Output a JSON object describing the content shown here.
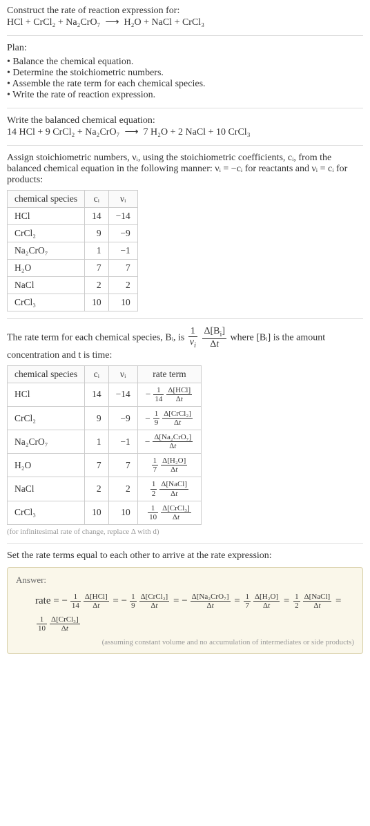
{
  "intro": {
    "line1": "Construct the rate of reaction expression for:",
    "eq_lhs": "HCl + CrCl₂ + Na₂CrO₇",
    "arrow": "⟶",
    "eq_rhs": "H₂O + NaCl + CrCl₃"
  },
  "plan": {
    "heading": "Plan:",
    "items": [
      "Balance the chemical equation.",
      "Determine the stoichiometric numbers.",
      "Assemble the rate term for each chemical species.",
      "Write the rate of reaction expression."
    ]
  },
  "balanced": {
    "heading": "Write the balanced chemical equation:",
    "eq_lhs": "14 HCl + 9 CrCl₂ + Na₂CrO₇",
    "arrow": "⟶",
    "eq_rhs": "7 H₂O + 2 NaCl + 10 CrCl₃"
  },
  "stoich": {
    "heading": "Assign stoichiometric numbers, νᵢ, using the stoichiometric coefficients, cᵢ, from the balanced chemical equation in the following manner: νᵢ = −cᵢ for reactants and νᵢ = cᵢ for products:",
    "cols": [
      "chemical species",
      "cᵢ",
      "νᵢ"
    ]
  },
  "rate_intro": {
    "prefix": "The rate term for each chemical species, Bᵢ, is ",
    "mid": " where [Bᵢ] is the amount concentration and t is time:",
    "cols": [
      "chemical species",
      "cᵢ",
      "νᵢ",
      "rate term"
    ],
    "footnote": "(for infinitesimal rate of change, replace Δ with d)"
  },
  "final": {
    "heading": "Set the rate terms equal to each other to arrive at the rate expression:",
    "answer_label": "Answer:",
    "rate_prefix": "rate = ",
    "footnote": "(assuming constant volume and no accumulation of intermediates or side products)"
  },
  "chart_data": {
    "type": "table",
    "stoichiometry": {
      "columns": [
        "chemical species",
        "c_i",
        "nu_i"
      ],
      "rows": [
        {
          "species": "HCl",
          "c": 14,
          "nu": -14
        },
        {
          "species": "CrCl₂",
          "c": 9,
          "nu": -9
        },
        {
          "species": "Na₂CrO₇",
          "c": 1,
          "nu": -1
        },
        {
          "species": "H₂O",
          "c": 7,
          "nu": 7
        },
        {
          "species": "NaCl",
          "c": 2,
          "nu": 2
        },
        {
          "species": "CrCl₃",
          "c": 10,
          "nu": 10
        }
      ]
    },
    "rate_terms": {
      "columns": [
        "chemical species",
        "c_i",
        "nu_i",
        "rate term"
      ],
      "rows": [
        {
          "species": "HCl",
          "c": 14,
          "nu": -14,
          "sign": "−",
          "coef_num": "1",
          "coef_den": "14",
          "delta": "Δ[HCl]"
        },
        {
          "species": "CrCl₂",
          "c": 9,
          "nu": -9,
          "sign": "−",
          "coef_num": "1",
          "coef_den": "9",
          "delta": "Δ[CrCl₂]"
        },
        {
          "species": "Na₂CrO₇",
          "c": 1,
          "nu": -1,
          "sign": "−",
          "coef_num": "",
          "coef_den": "",
          "delta": "Δ[Na₂CrO₇]"
        },
        {
          "species": "H₂O",
          "c": 7,
          "nu": 7,
          "sign": "",
          "coef_num": "1",
          "coef_den": "7",
          "delta": "Δ[H₂O]"
        },
        {
          "species": "NaCl",
          "c": 2,
          "nu": 2,
          "sign": "",
          "coef_num": "1",
          "coef_den": "2",
          "delta": "Δ[NaCl]"
        },
        {
          "species": "CrCl₃",
          "c": 10,
          "nu": 10,
          "sign": "",
          "coef_num": "1",
          "coef_den": "10",
          "delta": "Δ[CrCl₃]"
        }
      ]
    }
  }
}
